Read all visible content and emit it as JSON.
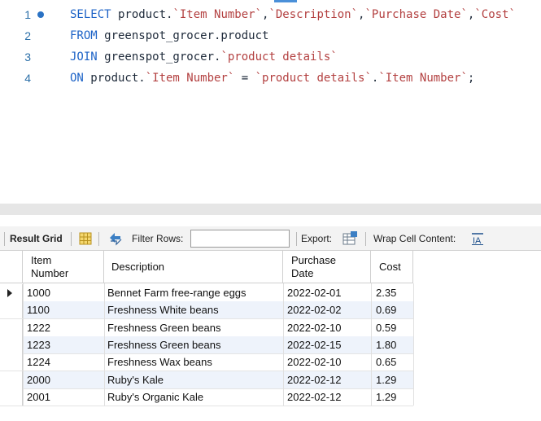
{
  "editor": {
    "lines": [
      {
        "number": "1",
        "tokens": [
          {
            "t": "SELECT",
            "c": "kw"
          },
          {
            "t": " product.",
            "c": "pl"
          },
          {
            "t": "`Item Number`",
            "c": "id"
          },
          {
            "t": ",",
            "c": "pl"
          },
          {
            "t": "`Description`",
            "c": "id"
          },
          {
            "t": ",",
            "c": "pl"
          },
          {
            "t": "`Purchase Date`",
            "c": "id"
          },
          {
            "t": ",",
            "c": "pl"
          },
          {
            "t": "`Cost`",
            "c": "id"
          }
        ]
      },
      {
        "number": "2",
        "tokens": [
          {
            "t": "FROM",
            "c": "kw"
          },
          {
            "t": " greenspot_grocer.product",
            "c": "pl"
          }
        ]
      },
      {
        "number": "3",
        "tokens": [
          {
            "t": "JOIN",
            "c": "kw"
          },
          {
            "t": " greenspot_grocer.",
            "c": "pl"
          },
          {
            "t": "`product details`",
            "c": "id"
          }
        ]
      },
      {
        "number": "4",
        "tokens": [
          {
            "t": "ON",
            "c": "kw"
          },
          {
            "t": " product.",
            "c": "pl"
          },
          {
            "t": "`Item Number`",
            "c": "id"
          },
          {
            "t": " = ",
            "c": "pl"
          },
          {
            "t": "`product details`",
            "c": "id"
          },
          {
            "t": ".",
            "c": "pl"
          },
          {
            "t": "`Item Number`",
            "c": "id"
          },
          {
            "t": ";",
            "c": "pl"
          }
        ]
      }
    ]
  },
  "toolbar": {
    "result_grid_label": "Result Grid",
    "filter_rows_label": "Filter Rows:",
    "filter_value": "",
    "export_label": "Export:",
    "wrap_label": "Wrap Cell Content:",
    "icons": [
      "grid-view-icon",
      "refresh-arrows-icon",
      "export-icon",
      "wrap-cell-icon"
    ]
  },
  "grid": {
    "headers": [
      [
        "Item",
        "Number"
      ],
      [
        "Description"
      ],
      [
        "Purchase",
        "Date"
      ],
      [
        "Cost"
      ]
    ],
    "rows": [
      [
        "1000",
        "Bennet Farm free-range eggs",
        "2022-02-01",
        "2.35"
      ],
      [
        "1100",
        "Freshness White beans",
        "2022-02-02",
        "0.69"
      ],
      [
        "1222",
        "Freshness Green beans",
        "2022-02-10",
        "0.59"
      ],
      [
        "1223",
        "Freshness Green beans",
        "2022-02-15",
        "1.80"
      ],
      [
        "1224",
        "Freshness Wax beans",
        "2022-02-10",
        "0.65"
      ],
      [
        "2000",
        "Ruby's Kale",
        "2022-02-12",
        "1.29"
      ],
      [
        "2001",
        "Ruby's Organic Kale",
        "2022-02-12",
        "1.29"
      ]
    ],
    "selected_row": 0
  },
  "colors": {
    "keyword": "#1d63c7",
    "identifier": "#b34040",
    "alt_row": "#eef3fb"
  }
}
